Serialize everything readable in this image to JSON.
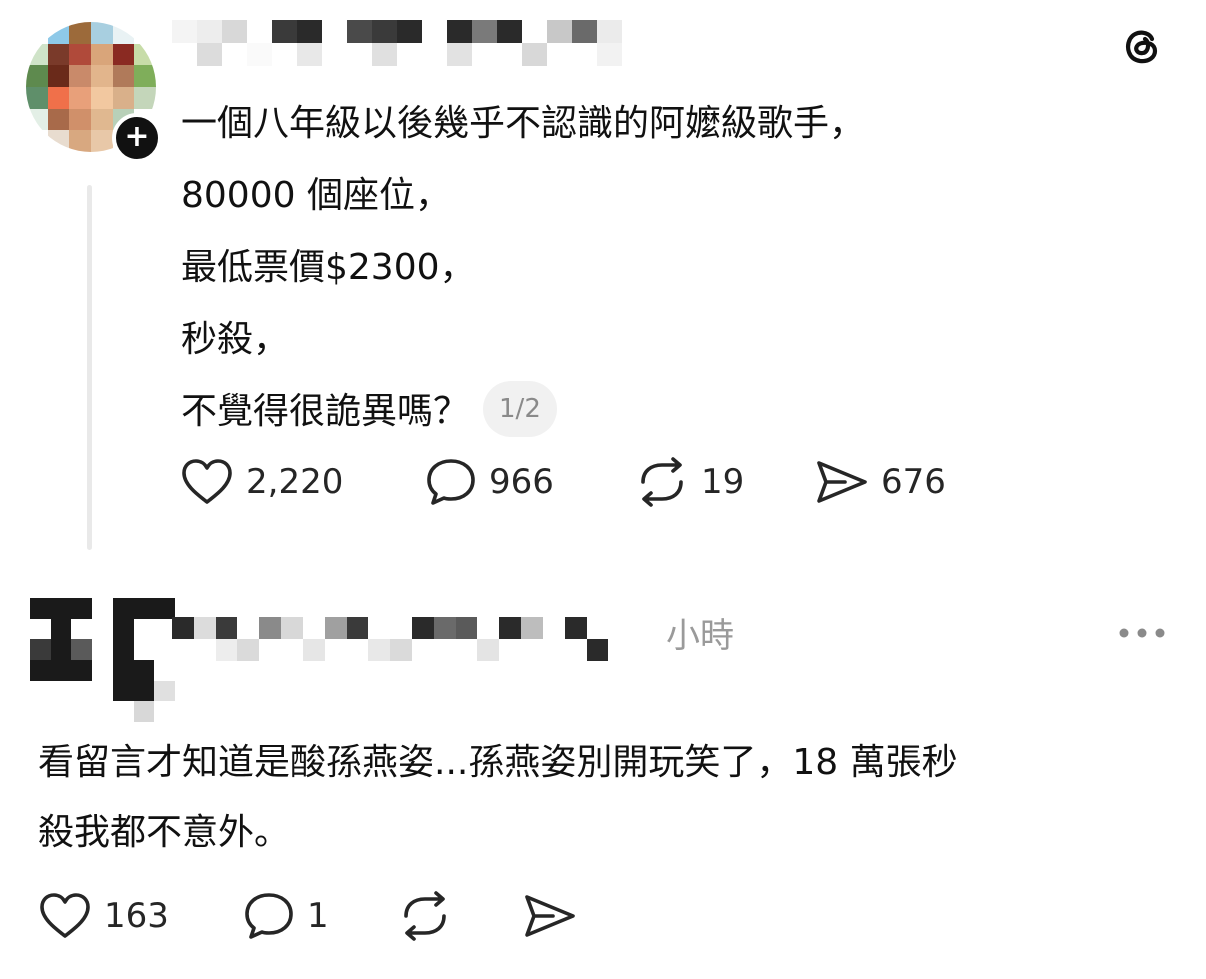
{
  "post_1": {
    "lines": [
      "一個八年級以後幾乎不認識的阿嬤級歌手，",
      "80000 個座位，",
      "最低票價$2300，",
      "秒殺，",
      "不覺得很詭異嗎？"
    ],
    "page_indicator": "1/2",
    "likes": "2,220",
    "replies": "966",
    "reposts": "19",
    "shares": "676"
  },
  "post_2": {
    "time": "小時",
    "lines": [
      "看留言才知道是酸孫燕姿...孫燕姿別開玩笑了，18 萬張秒",
      "殺我都不意外。"
    ],
    "likes": "163",
    "replies": "1"
  },
  "icons": {
    "like": "heart-icon",
    "reply": "comment-bubble-icon",
    "repost": "repost-icon",
    "share": "send-icon",
    "more": "more-horizontal-icon",
    "brand": "threads-logo-icon",
    "follow": "plus-icon"
  },
  "colors": {
    "text": "#111111",
    "muted": "#9a9a9a",
    "thread_line": "#e9e9e9",
    "pill_bg": "#f1f1f1"
  }
}
